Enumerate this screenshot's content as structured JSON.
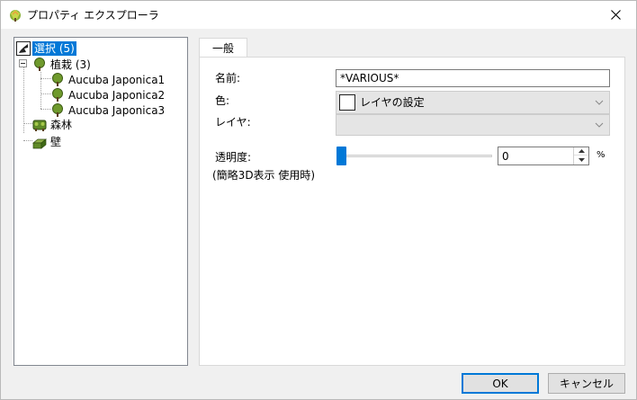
{
  "window": {
    "title": "プロパティ エクスプローラ"
  },
  "tree": {
    "selection": {
      "label": "選択 (5)"
    },
    "planting": {
      "label": "植栽 (3)",
      "children": [
        {
          "label": "Aucuba Japonica1"
        },
        {
          "label": "Aucuba Japonica2"
        },
        {
          "label": "Aucuba Japonica3"
        }
      ]
    },
    "forest": {
      "label": "森林"
    },
    "wall": {
      "label": "壁"
    }
  },
  "tabs": [
    {
      "label": "一般"
    }
  ],
  "form": {
    "name_label": "名前:",
    "name_value": "*VARIOUS*",
    "color_label": "色:",
    "color_value": "レイヤの設定",
    "layer_label": "レイヤ:",
    "layer_value": "",
    "transparency_label": "透明度:",
    "transparency_note": "(簡略3D表示 使用時)",
    "transparency_value": "0",
    "transparency_unit": "%"
  },
  "buttons": {
    "ok": "OK",
    "cancel": "キャンセル"
  },
  "colors": {
    "accent": "#0078d7",
    "selection_bg": "#0078d7",
    "dialog_bg": "#f0f0f0"
  }
}
